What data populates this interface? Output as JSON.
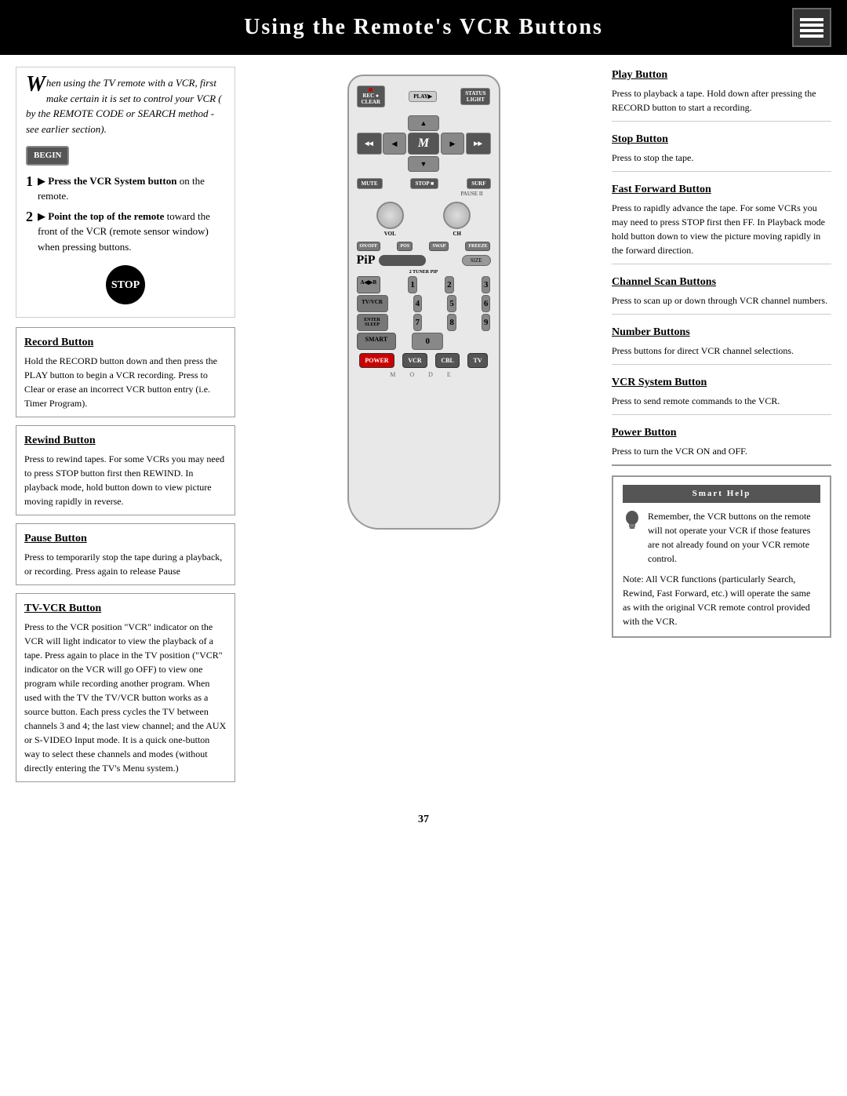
{
  "header": {
    "title": "Using the Remote's VCR Buttons",
    "icon_lines": 4
  },
  "intro": {
    "dropcap": "W",
    "text1": "hen using the TV remote with a VCR, first make certain it is set to control your VCR ( by the REMOTE CODE or SEARCH method - see earlier section).",
    "begin_label": "BEGIN",
    "step1_num": "1",
    "step1_text": "Press the VCR System button on the remote.",
    "step2_num": "2",
    "step2_text": "Point the top of the remote toward the front of the VCR (remote sensor window) when pressing buttons.",
    "stop_label": "STOP"
  },
  "left_features": [
    {
      "id": "record-button",
      "title": "Record Button",
      "text": "Hold the RECORD button down and then press the PLAY button to begin a VCR recording. Press to Clear or erase an incorrect VCR button entry (i.e. Timer Program)."
    },
    {
      "id": "rewind-button",
      "title": "Rewind Button",
      "text": "Press to rewind tapes. For some VCRs you may need to press STOP button first then REWIND. In playback mode, hold button down to view picture moving rapidly in reverse."
    },
    {
      "id": "pause-button",
      "title": "Pause Button",
      "text": "Press to temporarily stop the tape during a playback, or recording. Press again to release Pause"
    },
    {
      "id": "tv-vcr-button",
      "title": "TV-VCR Button",
      "text": "Press to the VCR position \"VCR\" indicator on the VCR will light indicator to view the playback of a tape. Press again to place in the TV position (\"VCR\" indicator on the VCR will go OFF) to view one program while recording another program. When used with the TV the TV/VCR button works as a source button. Each press cycles the TV between channels 3 and 4; the last view channel; and the AUX or S-VIDEO Input mode. It is a quick one-button way to select these channels and modes (without directly entering the TV's Menu system.)"
    }
  ],
  "right_features": [
    {
      "id": "play-button",
      "title": "Play Button",
      "text": "Press to playback a tape. Hold down after pressing the RECORD button to start a recording."
    },
    {
      "id": "stop-button",
      "title": "Stop Button",
      "text": "Press to stop the tape."
    },
    {
      "id": "fast-forward-button",
      "title": "Fast Forward Button",
      "text": "Press to rapidly advance the tape. For some VCRs you may need to press STOP first then FF. In Playback mode hold button down to view the picture moving rapidly in the forward direction."
    },
    {
      "id": "channel-scan-buttons",
      "title": "Channel Scan Buttons",
      "text": "Press to scan up or down through VCR channel numbers."
    },
    {
      "id": "number-buttons",
      "title": "Number Buttons",
      "text": "Press buttons for direct VCR channel selections."
    },
    {
      "id": "vcr-system-button",
      "title": "VCR System Button",
      "text": "Press to send remote commands to the VCR."
    },
    {
      "id": "power-button",
      "title": "Power Button",
      "text": "Press to turn the VCR ON and OFF."
    }
  ],
  "smart_help": {
    "header": "Smart Help",
    "text1": "Remember, the VCR buttons on the remote will not operate your VCR if those features are not already found on your VCR remote control.",
    "text2": "Note: All VCR functions (particularly Search, Rewind, Fast Forward, etc.) will operate the same as with the original VCR remote control provided with the VCR."
  },
  "remote": {
    "rec_label": "REC ●",
    "clear_label": "CLEAR",
    "play_label": "PLAY▶",
    "status_label": "STATUS",
    "light_label": "LIGHT",
    "rew_label": "REW",
    "rew_symbol": "◀◀",
    "ff_label": "FF",
    "ff_symbol": "▶▶",
    "menu_label": "MENU",
    "m_label": "M",
    "up_arrow": "▲",
    "down_arrow": "▼",
    "left_arrow": "◀",
    "right_arrow": "▶",
    "pause_label": "PAUSE II",
    "mute_label": "MUTE",
    "stop_label": "STOP ■",
    "surf_label": "SURF",
    "vol_label": "VOL",
    "ch_label": "CH",
    "on_off_label": "ON/OFF",
    "pos_label": "POS",
    "swap_label": "SWAP",
    "freeze_label": "FREEZE",
    "pip_logo": "PiP",
    "size_label": "SIZE",
    "tuner_label": "2 TUNER PIP",
    "ab_label": "A◀▶B",
    "nums": [
      "1",
      "2",
      "3",
      "4",
      "5",
      "6",
      "7",
      "8",
      "9",
      "0"
    ],
    "tv_vcr_label": "TV/VCR",
    "enter_label": "ENTER",
    "sleep_label": "SLEEP",
    "smart_label": "SMART",
    "power_label": "POWER",
    "vcr_label": "VCR",
    "cbl_label": "CBL",
    "tv_label": "TV",
    "mode_letters": "M  O  D  E"
  },
  "page_number": "37"
}
